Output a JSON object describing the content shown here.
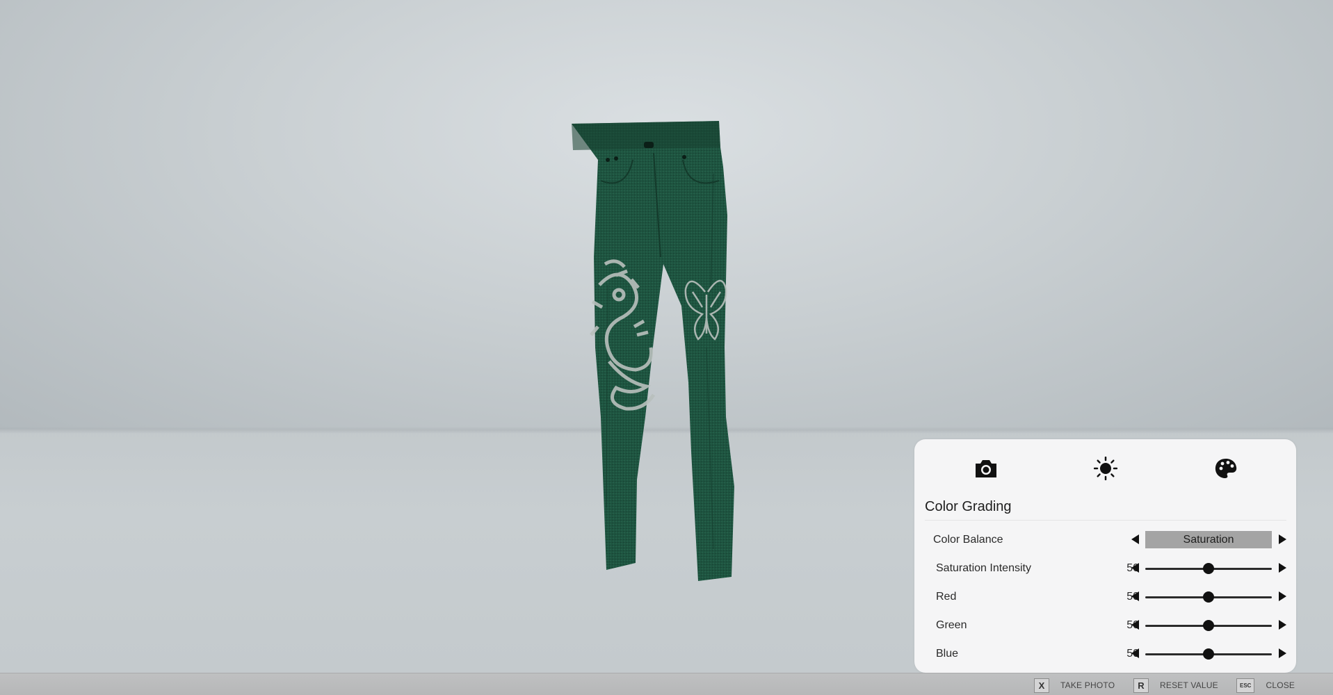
{
  "panel": {
    "tabs": [
      {
        "icon": "camera-icon"
      },
      {
        "icon": "sun-icon"
      },
      {
        "icon": "palette-icon"
      }
    ],
    "section_title": "Color Grading",
    "color_balance": {
      "label": "Color Balance",
      "value": "Saturation"
    },
    "sliders": [
      {
        "label": "Saturation Intensity",
        "value": 50,
        "display": "50"
      },
      {
        "label": "Red",
        "value": 50,
        "display": "50"
      },
      {
        "label": "Green",
        "value": 50,
        "display": "50"
      },
      {
        "label": "Blue",
        "value": 50,
        "display": "50"
      }
    ],
    "slider_max": 100
  },
  "hints": [
    {
      "key": "X",
      "label": "TAKE PHOTO"
    },
    {
      "key": "R",
      "label": "RESET VALUE"
    },
    {
      "key": "ESC",
      "label": "CLOSE"
    }
  ],
  "colors": {
    "pants": "#1d4f3c",
    "print": "#b9c0bd"
  }
}
